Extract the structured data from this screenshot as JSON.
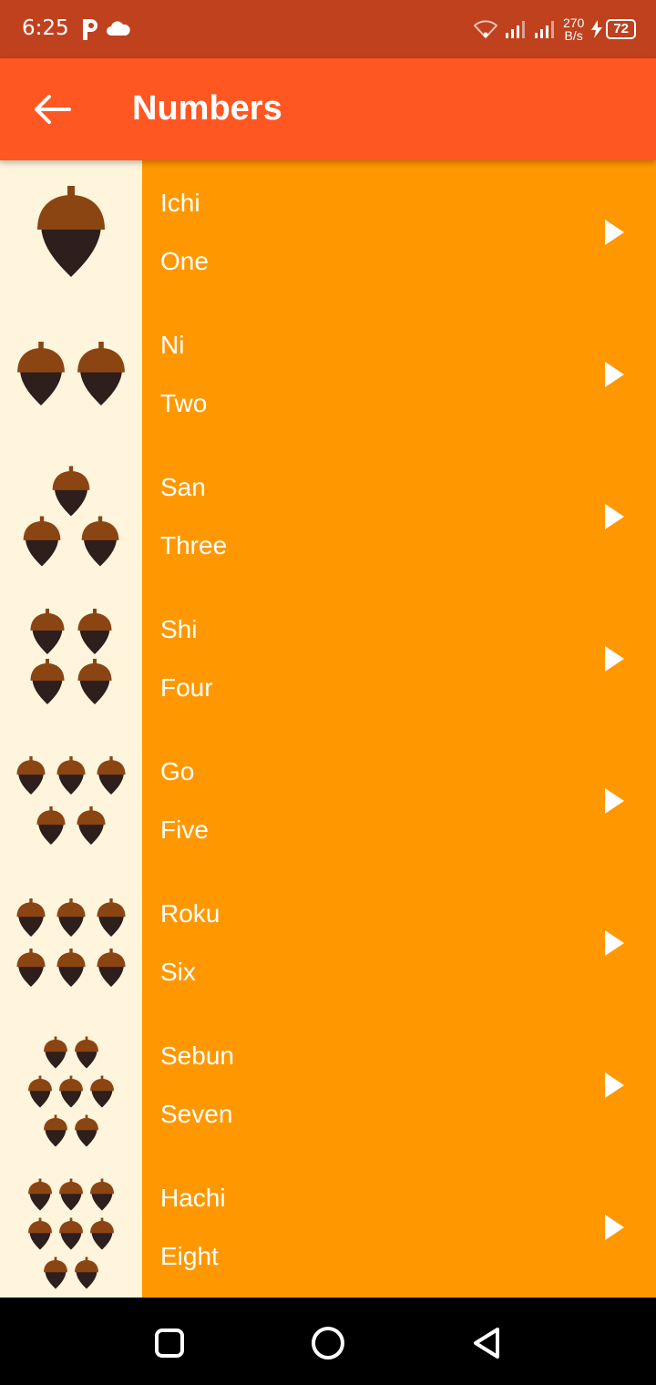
{
  "status_bar": {
    "time": "6:25",
    "net_speed_value": "270",
    "net_speed_unit": "B/s",
    "battery": "72"
  },
  "app_bar": {
    "title": "Numbers",
    "back_icon": "arrow-left-icon"
  },
  "colors": {
    "status_bar": "#BF411D",
    "app_bar": "#FF5722",
    "row_background": "#FF9800",
    "image_background": "#FFF5DD",
    "acorn_cap": "#8B4513",
    "acorn_body": "#2E1E1C"
  },
  "items": [
    {
      "japanese": "Ichi",
      "english": "One",
      "acorn_count": 1
    },
    {
      "japanese": "Ni",
      "english": "Two",
      "acorn_count": 2
    },
    {
      "japanese": "San",
      "english": "Three",
      "acorn_count": 3
    },
    {
      "japanese": "Shi",
      "english": "Four",
      "acorn_count": 4
    },
    {
      "japanese": "Go",
      "english": "Five",
      "acorn_count": 5
    },
    {
      "japanese": "Roku",
      "english": "Six",
      "acorn_count": 6
    },
    {
      "japanese": "Sebun",
      "english": "Seven",
      "acorn_count": 7
    },
    {
      "japanese": "Hachi",
      "english": "Eight",
      "acorn_count": 8
    }
  ],
  "nav_bar": {
    "recents_icon": "square-icon",
    "home_icon": "circle-icon",
    "back_icon": "triangle-back-icon"
  }
}
